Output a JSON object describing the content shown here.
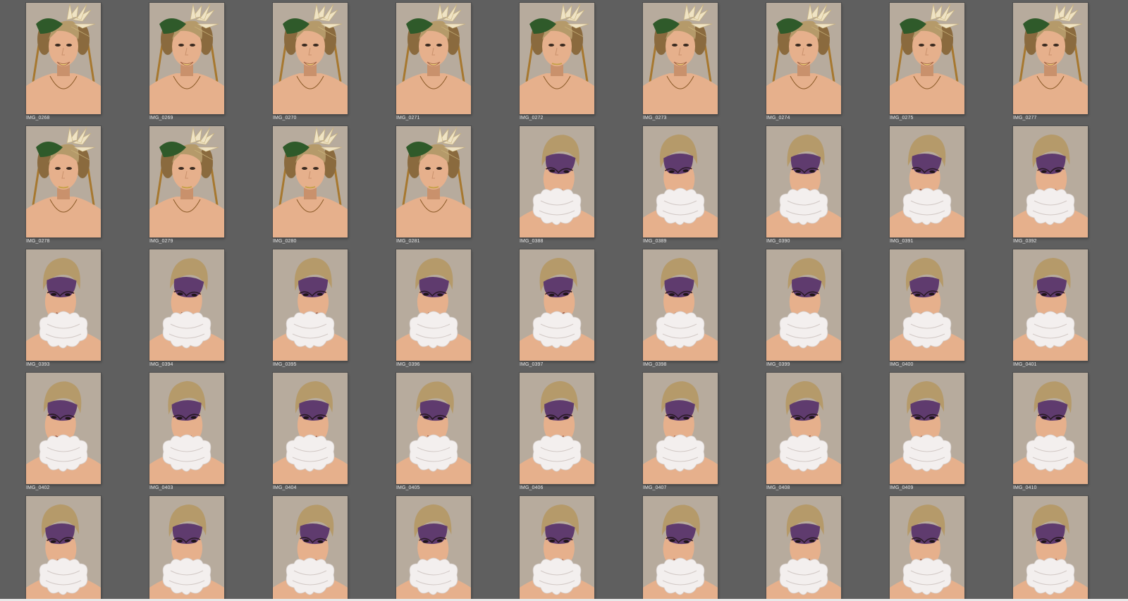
{
  "app": {
    "name": "image-thumbnail-browser"
  },
  "colors": {
    "background": "#5f5f5f",
    "backdrop": "#b7ab9d",
    "skin": "#e6b08c",
    "skin_shadow": "#c9916c",
    "hair_blonde": "#b59a6a",
    "hair_braid": "#8a6a3e",
    "mask_purple": "#5f3b6e",
    "ruff_white": "#f3efee",
    "leaf_green": "#2f5a2a",
    "flower_cream": "#efe3c4",
    "label_text": "#e6e6e6"
  },
  "thumbnails": [
    {
      "filename": "IMG_0268",
      "style": "flower",
      "smile": true
    },
    {
      "filename": "IMG_0269",
      "style": "flower",
      "smile": true
    },
    {
      "filename": "IMG_0270",
      "style": "flower",
      "smile": true
    },
    {
      "filename": "IMG_0271",
      "style": "flower",
      "smile": true
    },
    {
      "filename": "IMG_0272",
      "style": "flower",
      "smile": false
    },
    {
      "filename": "IMG_0273",
      "style": "flower",
      "smile": true
    },
    {
      "filename": "IMG_0274",
      "style": "flower",
      "smile": true
    },
    {
      "filename": "IMG_0275",
      "style": "flower",
      "smile": true
    },
    {
      "filename": "IMG_0277",
      "style": "flower",
      "smile": true
    },
    {
      "filename": "IMG_0278",
      "style": "flower",
      "smile": false
    },
    {
      "filename": "IMG_0279",
      "style": "flower",
      "smile": false
    },
    {
      "filename": "IMG_0280",
      "style": "flower",
      "smile": false
    },
    {
      "filename": "IMG_0281",
      "style": "flower",
      "smile": false
    },
    {
      "filename": "IMG_0388",
      "style": "mask",
      "smile": false
    },
    {
      "filename": "IMG_0389",
      "style": "mask",
      "smile": false
    },
    {
      "filename": "IMG_0390",
      "style": "mask",
      "smile": false
    },
    {
      "filename": "IMG_0391",
      "style": "mask",
      "smile": false
    },
    {
      "filename": "IMG_0392",
      "style": "mask",
      "smile": false
    },
    {
      "filename": "IMG_0393",
      "style": "mask",
      "smile": false
    },
    {
      "filename": "IMG_0394",
      "style": "mask",
      "smile": false
    },
    {
      "filename": "IMG_0395",
      "style": "mask",
      "smile": false
    },
    {
      "filename": "IMG_0396",
      "style": "mask",
      "smile": false
    },
    {
      "filename": "IMG_0397",
      "style": "mask",
      "smile": false
    },
    {
      "filename": "IMG_0398",
      "style": "mask",
      "smile": false
    },
    {
      "filename": "IMG_0399",
      "style": "mask",
      "smile": false
    },
    {
      "filename": "IMG_0400",
      "style": "mask",
      "smile": false
    },
    {
      "filename": "IMG_0401",
      "style": "mask",
      "smile": false
    },
    {
      "filename": "IMG_0402",
      "style": "mask",
      "smile": false
    },
    {
      "filename": "IMG_0403",
      "style": "mask",
      "smile": false
    },
    {
      "filename": "IMG_0404",
      "style": "mask",
      "smile": false
    },
    {
      "filename": "IMG_0405",
      "style": "mask",
      "smile": false
    },
    {
      "filename": "IMG_0406",
      "style": "mask",
      "smile": false
    },
    {
      "filename": "IMG_0407",
      "style": "mask",
      "smile": false
    },
    {
      "filename": "IMG_0408",
      "style": "mask",
      "smile": false
    },
    {
      "filename": "IMG_0409",
      "style": "mask",
      "smile": false
    },
    {
      "filename": "IMG_0410",
      "style": "mask",
      "smile": false
    },
    {
      "filename": "",
      "style": "mask",
      "smile": false
    },
    {
      "filename": "",
      "style": "mask",
      "smile": false
    },
    {
      "filename": "",
      "style": "mask",
      "smile": false
    },
    {
      "filename": "",
      "style": "mask",
      "smile": false
    },
    {
      "filename": "",
      "style": "mask",
      "smile": false
    },
    {
      "filename": "",
      "style": "mask",
      "smile": false
    },
    {
      "filename": "",
      "style": "mask",
      "smile": false
    },
    {
      "filename": "",
      "style": "mask",
      "smile": false
    },
    {
      "filename": "",
      "style": "mask",
      "smile": false
    }
  ]
}
